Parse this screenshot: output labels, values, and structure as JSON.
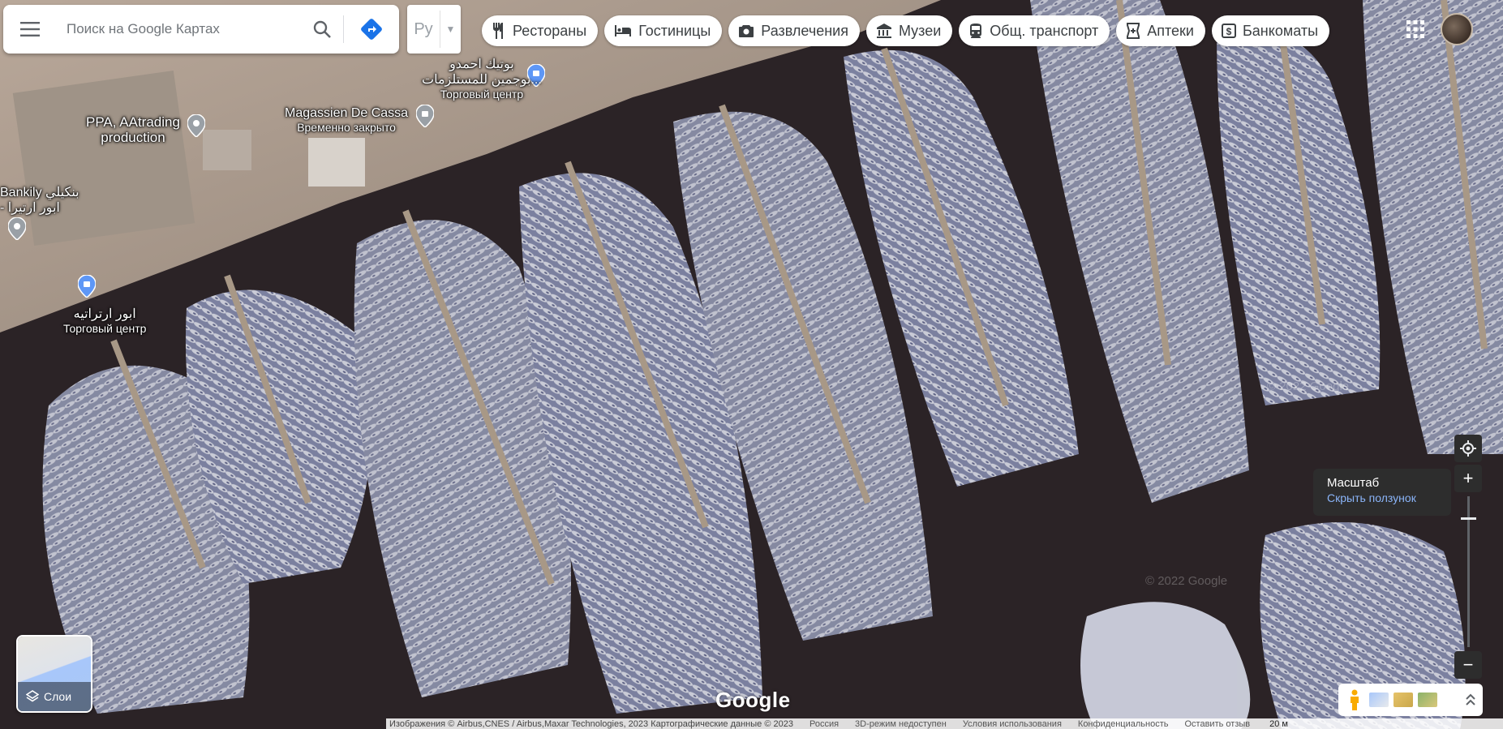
{
  "search": {
    "placeholder": "Поиск на Google Картах"
  },
  "language_box": {
    "text": "Ру"
  },
  "chips": [
    {
      "label": "Рестораны",
      "icon": "fork-knife-icon"
    },
    {
      "label": "Гостиницы",
      "icon": "bed-icon"
    },
    {
      "label": "Развлечения",
      "icon": "camera-icon"
    },
    {
      "label": "Музеи",
      "icon": "museum-icon"
    },
    {
      "label": "Общ. транспорт",
      "icon": "train-icon"
    },
    {
      "label": "Аптеки",
      "icon": "pharmacy-icon"
    },
    {
      "label": "Банкоматы",
      "icon": "atm-icon"
    }
  ],
  "places": {
    "p1": {
      "name": "بوتيك احمدو",
      "name2": "بوجمين للمستلزمات...",
      "category": "Торговый центр"
    },
    "p2": {
      "name": "Magassien De Cassa",
      "category": "Временно закрыто"
    },
    "p3": {
      "name": "PPA, AAtrading",
      "name2": "production"
    },
    "p4": {
      "name": "Bankily بنكيلي",
      "name2": "- ابور ارتيرا"
    },
    "p5": {
      "name": "ابور ارتراتيه",
      "category": "Торговый центр"
    }
  },
  "scale_tip": {
    "title": "Масштаб",
    "link": "Скрыть ползунок"
  },
  "layers": {
    "label": "Слои"
  },
  "google_logo": "Google",
  "watermarks": [
    "© 2022 Google",
    "© 2022 Google"
  ],
  "footer": {
    "imagery": "Изображения © Airbus,CNES / Airbus,Maxar Technologies, 2023 Картографические данные © 2023",
    "country": "Россия",
    "mode3d": "3D-режим недоступен",
    "terms": "Условия использования",
    "privacy": "Конфиденциальность",
    "feedback": "Оставить отзыв",
    "scale": "20 м"
  },
  "colors": {
    "water": "#2b2326",
    "link": "#8ab4f8",
    "pin": "#5e97f6"
  }
}
